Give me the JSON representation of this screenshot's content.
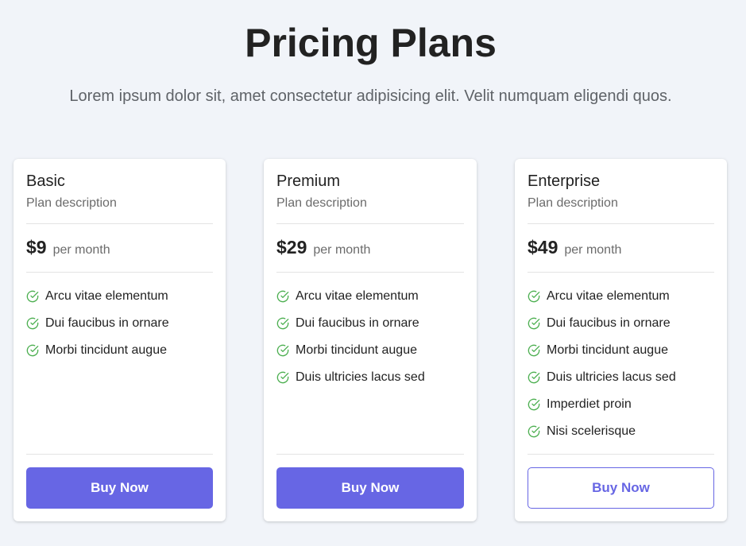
{
  "header": {
    "title": "Pricing Plans",
    "subtitle": "Lorem ipsum dolor sit, amet consectetur adipisicing elit. Velit numquam eligendi quos."
  },
  "plans": [
    {
      "name": "Basic",
      "description": "Plan description",
      "price": "$9",
      "period": "per month",
      "features": [
        "Arcu vitae elementum",
        "Dui faucibus in ornare",
        "Morbi tincidunt augue"
      ],
      "button_label": "Buy Now",
      "button_style": "filled"
    },
    {
      "name": "Premium",
      "description": "Plan description",
      "price": "$29",
      "period": "per month",
      "features": [
        "Arcu vitae elementum",
        "Dui faucibus in ornare",
        "Morbi tincidunt augue",
        "Duis ultricies lacus sed"
      ],
      "button_label": "Buy Now",
      "button_style": "filled"
    },
    {
      "name": "Enterprise",
      "description": "Plan description",
      "price": "$49",
      "period": "per month",
      "features": [
        "Arcu vitae elementum",
        "Dui faucibus in ornare",
        "Morbi tincidunt augue",
        "Duis ultricies lacus sed",
        "Imperdiet proin",
        "Nisi scelerisque"
      ],
      "button_label": "Buy Now",
      "button_style": "outline"
    }
  ],
  "colors": {
    "accent": "#6766e4",
    "check": "#4caf50",
    "background": "#f1f4f9"
  },
  "icons": {
    "feature": "check-circle-icon"
  }
}
